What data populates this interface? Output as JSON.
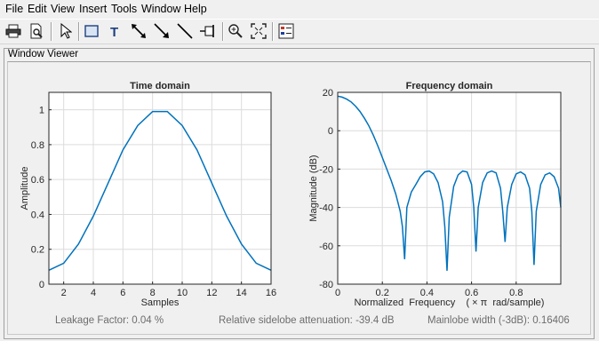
{
  "menu": [
    "File",
    "Edit",
    "View",
    "Insert",
    "Tools",
    "Window",
    "Help"
  ],
  "toolbar": [
    "print-icon",
    "print-preview-icon",
    "pointer-arrow-icon",
    "rectangle-icon",
    "text-icon",
    "double-arrow-icon",
    "arrow-icon",
    "line-icon",
    "pin-icon",
    "zoom-in-icon",
    "fit-to-window-icon",
    "legend-icon"
  ],
  "panel": {
    "title": "Window Viewer"
  },
  "status": {
    "leakage": "Leakage Factor: 0.04 %",
    "sidelobe": "Relative sidelobe attenuation: -39.4 dB",
    "mainlobe": "Mainlobe width (-3dB): 0.16406"
  },
  "colors": {
    "line": "#0072bd",
    "grid": "#dcdcdc",
    "axes": "#262626"
  },
  "chart_data": [
    {
      "type": "line",
      "title": "Time domain",
      "xlabel": "Samples",
      "ylabel": "Amplitude",
      "xlim": [
        1,
        16
      ],
      "ylim": [
        0,
        1.1
      ],
      "xticks": [
        "2",
        "4",
        "6",
        "8",
        "10",
        "12",
        "14",
        "16"
      ],
      "yticks": [
        "0",
        "0.2",
        "0.4",
        "0.6",
        "0.8",
        "1"
      ],
      "grid": true,
      "x": [
        1,
        2,
        3,
        4,
        5,
        6,
        7,
        8,
        9,
        10,
        11,
        12,
        13,
        14,
        15,
        16
      ],
      "y": [
        0.08,
        0.12,
        0.23,
        0.39,
        0.58,
        0.77,
        0.91,
        0.99,
        0.99,
        0.91,
        0.77,
        0.58,
        0.39,
        0.23,
        0.12,
        0.08
      ]
    },
    {
      "type": "line",
      "title": "Frequency domain",
      "xlabel": "Normalized  Frequency    ( × π  rad/sample)",
      "ylabel": "Magnitude (dB)",
      "xlim": [
        0,
        1
      ],
      "ylim": [
        -80,
        20
      ],
      "xticks": [
        "0",
        "0.2",
        "0.4",
        "0.6",
        "0.8"
      ],
      "yticks": [
        "20",
        "0",
        "-20",
        "-40",
        "-60",
        "-80"
      ],
      "grid": true,
      "x": [
        0,
        0.02,
        0.04,
        0.06,
        0.08,
        0.1,
        0.12,
        0.14,
        0.16,
        0.18,
        0.2,
        0.22,
        0.24,
        0.26,
        0.28,
        0.29,
        0.3,
        0.31,
        0.33,
        0.35,
        0.37,
        0.39,
        0.41,
        0.43,
        0.45,
        0.47,
        0.48,
        0.49,
        0.5,
        0.52,
        0.54,
        0.56,
        0.58,
        0.6,
        0.61,
        0.62,
        0.63,
        0.65,
        0.67,
        0.69,
        0.71,
        0.73,
        0.74,
        0.75,
        0.76,
        0.78,
        0.8,
        0.82,
        0.84,
        0.86,
        0.87,
        0.88,
        0.89,
        0.91,
        0.93,
        0.95,
        0.97,
        0.99,
        1.0
      ],
      "y": [
        18,
        17.5,
        16.5,
        15,
        12.8,
        10,
        6.5,
        2.5,
        -2.5,
        -8,
        -14,
        -20,
        -26,
        -33,
        -42,
        -50,
        -67,
        -40,
        -32,
        -28,
        -24,
        -21.5,
        -21,
        -22.5,
        -27,
        -37,
        -50,
        -73,
        -45,
        -29,
        -23,
        -21,
        -21.5,
        -28,
        -40,
        -63,
        -40,
        -27,
        -22,
        -21,
        -22,
        -30,
        -42,
        -58,
        -40,
        -28,
        -22.5,
        -21.5,
        -23,
        -30,
        -42,
        -70,
        -42,
        -28,
        -23,
        -22,
        -24,
        -30,
        -40
      ]
    }
  ]
}
